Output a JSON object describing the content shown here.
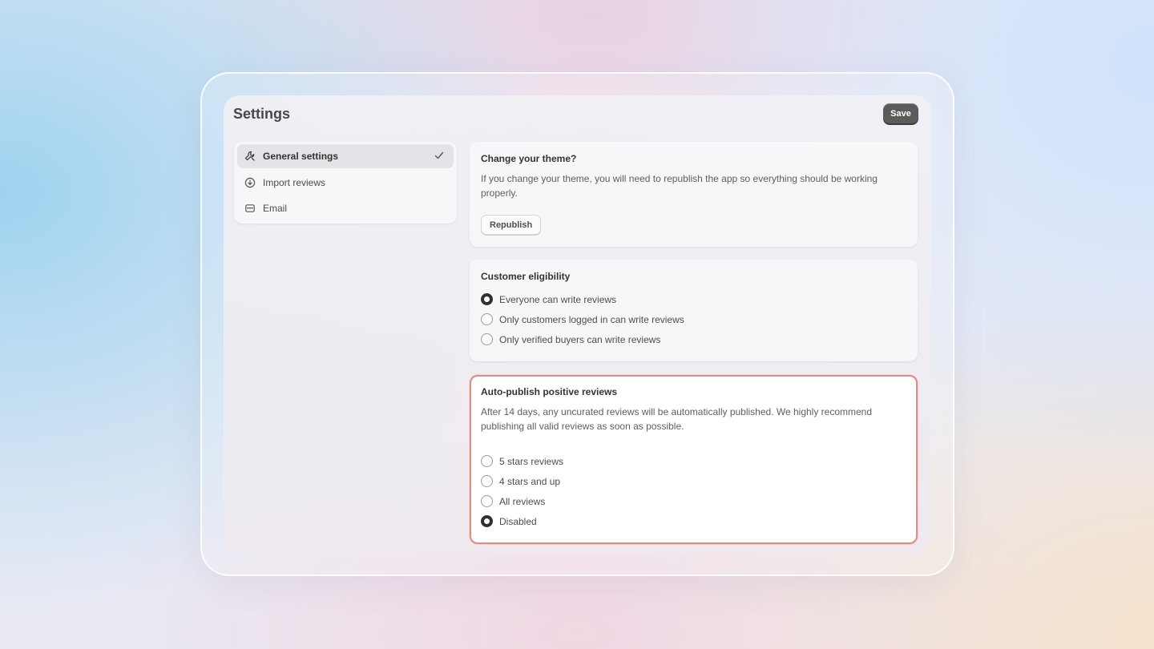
{
  "header": {
    "title": "Settings",
    "save_label": "Save"
  },
  "sidebar": {
    "items": [
      {
        "label": "General settings",
        "icon": "wrench-icon",
        "active": true
      },
      {
        "label": "Import reviews",
        "icon": "download-circle-icon",
        "active": false
      },
      {
        "label": "Email",
        "icon": "envelope-icon",
        "active": false
      }
    ]
  },
  "theme": {
    "title": "Change your theme?",
    "description": "If you change your theme, you will need to republish the app so everything should be working properly.",
    "button_label": "Republish"
  },
  "eligibility": {
    "title": "Customer eligibility",
    "options": [
      {
        "label": "Everyone can write reviews",
        "selected": true
      },
      {
        "label": "Only customers logged in can write reviews",
        "selected": false
      },
      {
        "label": "Only verified buyers can write reviews",
        "selected": false
      }
    ]
  },
  "autopublish": {
    "title": "Auto-publish positive reviews",
    "description": "After 14 days, any uncurated reviews will be automatically published. We highly recommend publishing all valid reviews as soon as possible.",
    "options": [
      {
        "label": "5 stars reviews",
        "selected": false
      },
      {
        "label": "4 stars and up",
        "selected": false
      },
      {
        "label": "All reviews",
        "selected": false
      },
      {
        "label": "Disabled",
        "selected": true
      }
    ],
    "highlight_color": "#e48b86"
  }
}
